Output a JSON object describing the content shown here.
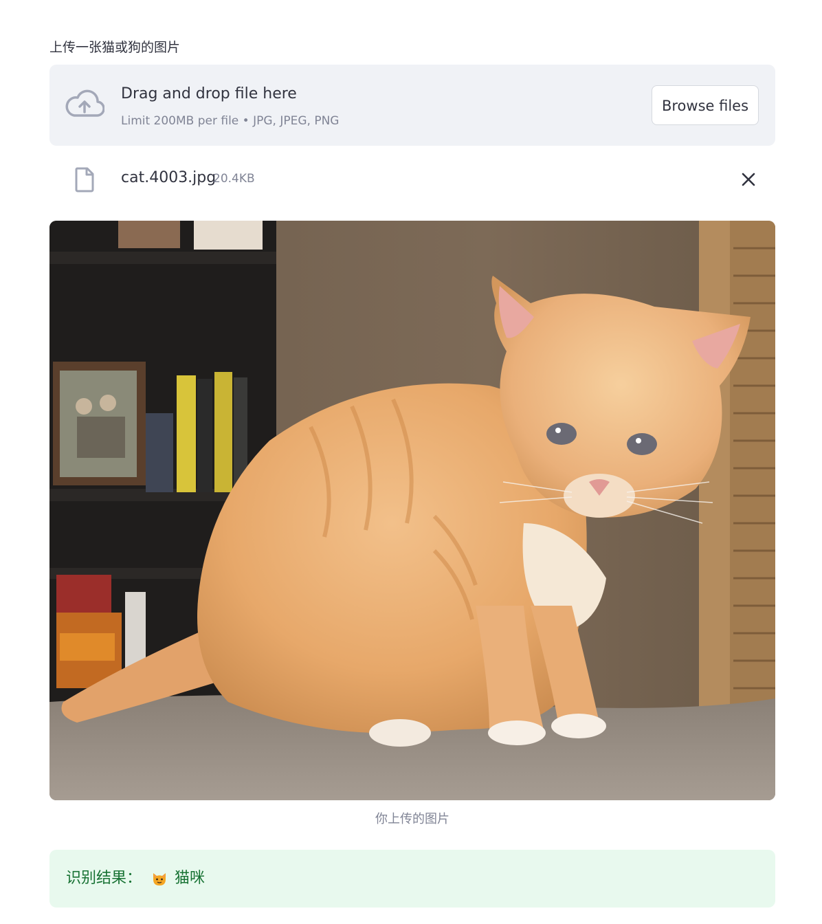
{
  "uploader": {
    "label": "上传一张猫或狗的图片",
    "drop_title": "Drag and drop file here",
    "limit_text": "Limit 200MB per file • JPG, JPEG, PNG",
    "browse_label": "Browse files"
  },
  "uploaded_file": {
    "name": "cat.4003.jpg",
    "size": "20.4KB"
  },
  "image": {
    "caption": "你上传的图片"
  },
  "result": {
    "label": "识别结果：",
    "emoji": "cat-face-icon",
    "value": "猫咪"
  },
  "colors": {
    "dropzone_bg": "#f0f2f6",
    "success_bg": "#e8f9ee",
    "success_text": "#177233",
    "muted_text": "#808495",
    "icon_color": "#a3a8b8"
  }
}
